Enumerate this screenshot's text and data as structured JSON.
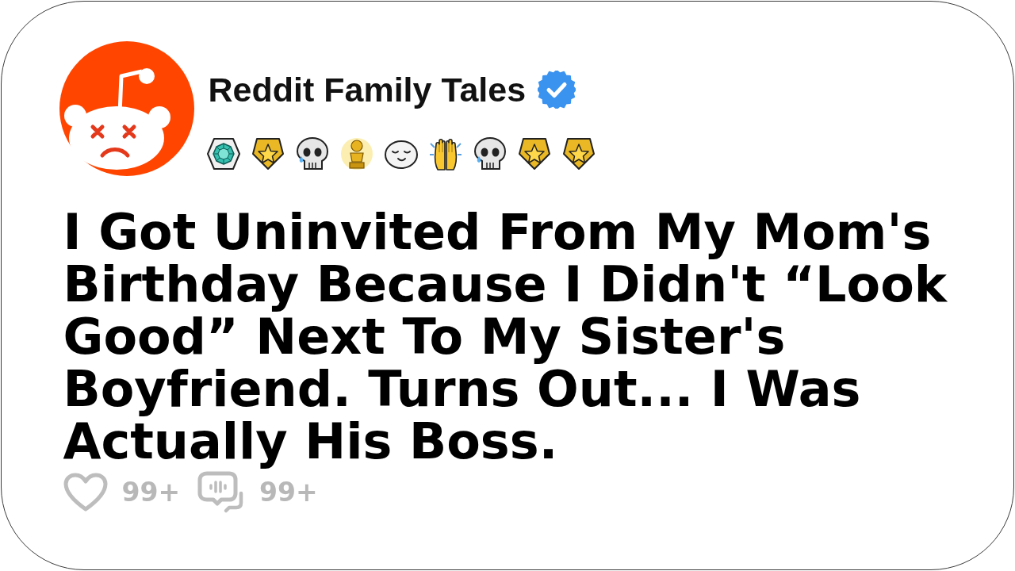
{
  "channel": {
    "name": "Reddit Family Tales",
    "verified": true
  },
  "awards": [
    {
      "kind": "gem"
    },
    {
      "kind": "star"
    },
    {
      "kind": "skull"
    },
    {
      "kind": "trophy"
    },
    {
      "kind": "seal"
    },
    {
      "kind": "clap"
    },
    {
      "kind": "skull"
    },
    {
      "kind": "star"
    },
    {
      "kind": "star"
    }
  ],
  "post": {
    "title": "I Got Uninvited From My Mom's Birthday Because I Didn't “Look Good” Next To My Sister's Boyfriend. Turns Out... I Was Actually His Boss."
  },
  "stats": {
    "likes": "99+",
    "comments": "99+"
  }
}
